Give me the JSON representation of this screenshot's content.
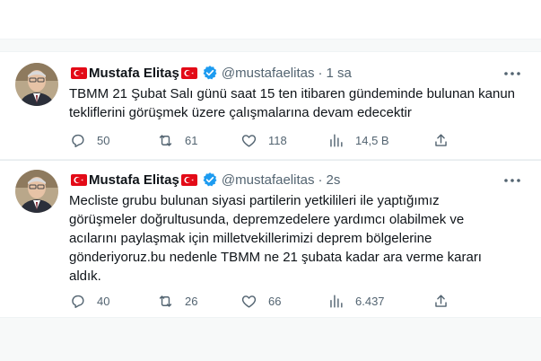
{
  "tweets": [
    {
      "name": "Mustafa Elitaş",
      "handle": "@mustafaelitas",
      "time": "1 sa",
      "text": "TBMM 21 Şubat Salı günü saat 15 ten itibaren gündeminde bulunan kanun\ntekliflerini görüşmek üzere çalışmalarına devam edecektir",
      "replies": "50",
      "retweets": "61",
      "likes": "118",
      "views": "14,5 B"
    },
    {
      "name": "Mustafa Elitaş",
      "handle": "@mustafaelitas",
      "time": "2s",
      "text": "Mecliste grubu bulunan siyasi partilerin yetkilileri ile yaptığımız\ngörüşmeler doğrultusunda, depremzedelere yardımcı olabilmek ve\nacılarını paylaşmak için milletvekillerimizi deprem bölgelerine\ngönderiyoruz.bu nedenle TBMM ne  21 şubata kadar ara verme kararı\naldık.",
      "replies": "40",
      "retweets": "26",
      "likes": "66",
      "views": "6.437"
    }
  ],
  "separator": "·",
  "colors": {
    "text": "#0f1419",
    "secondary": "#536471",
    "verified": "#1d9bf0",
    "flag": "#e30a17",
    "background": "#f7f9f9"
  },
  "icons": [
    "turkish-flag-icon",
    "verified-badge-icon",
    "more-icon",
    "reply-icon",
    "retweet-icon",
    "like-icon",
    "views-icon",
    "share-icon"
  ]
}
